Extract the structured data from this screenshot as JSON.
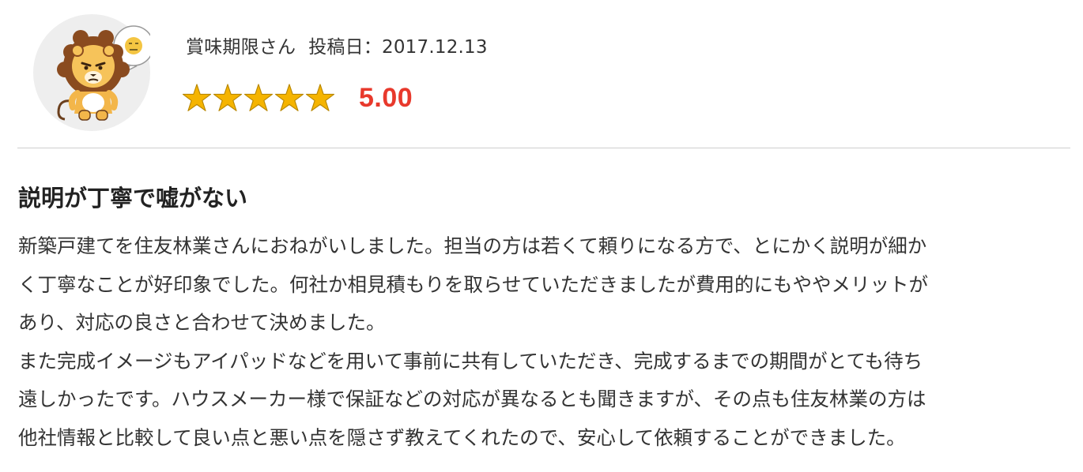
{
  "reviewer": {
    "avatar_icon": "lion-mascot-icon",
    "bubble_icon": "unhappy-face-icon",
    "name": "賞味期限さん",
    "post_date_label": "投稿日：",
    "post_date": "2017.12.13"
  },
  "rating": {
    "stars_total": 5,
    "stars_filled": 5,
    "star_color": "#f5b400",
    "score": "5.00",
    "score_color": "#e8392c"
  },
  "review": {
    "title": "説明が丁寧で嘘がない",
    "lines": [
      "新築戸建てを住友林業さんにおねがいしました。担当の方は若くて頼りになる方で、とにかく説明が細か",
      "く丁寧なことが好印象でした。何社か相見積もりを取らせていただきましたが費用的にもややメリットが",
      "あり、対応の良さと合わせて決めました。",
      "また完成イメージもアイパッドなどを用いて事前に共有していただき、完成するまでの期間がとても待ち",
      "遠しかったです。ハウスメーカー様で保証などの対応が異なるとも聞きますが、その点も住友林業の方は",
      "他社情報と比較して良い点と悪い点を隠さず教えてくれたので、安心して依頼することができました。"
    ]
  }
}
